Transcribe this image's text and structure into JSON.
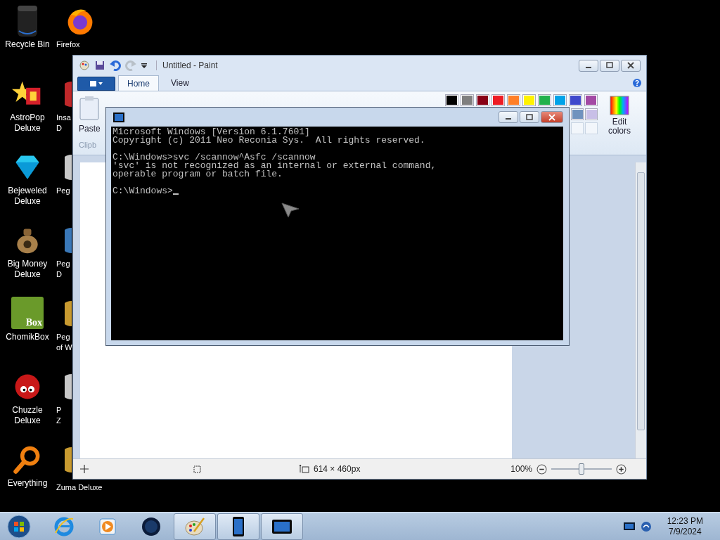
{
  "desktop_icons": [
    {
      "label": [
        "Recycle Bin"
      ],
      "kind": "bin"
    },
    {
      "label": [
        "AstroPop",
        "Deluxe"
      ],
      "kind": "star"
    },
    {
      "label": [
        "Bejeweled",
        "Deluxe"
      ],
      "kind": "gem"
    },
    {
      "label": [
        "Big Money",
        "Deluxe"
      ],
      "kind": "moneybag"
    },
    {
      "label": [
        "ChomikBox"
      ],
      "kind": "box",
      "icon_text": "Box"
    },
    {
      "label": [
        "Chuzzle",
        "Deluxe"
      ],
      "kind": "fuzzball"
    },
    {
      "label": [
        "Everything"
      ],
      "kind": "magnifier"
    }
  ],
  "desktop_icons_column_2": [
    {
      "label": [
        "Firefox"
      ],
      "kind": "firefox"
    },
    {
      "label": [
        "Insa",
        "D"
      ],
      "kind": "red"
    },
    {
      "label": [
        "Peg"
      ],
      "kind": "grey"
    },
    {
      "label": [
        "Peg",
        "D"
      ],
      "kind": "blue"
    },
    {
      "label": [
        "Peg",
        "of W"
      ],
      "kind": "gold"
    },
    {
      "label": [
        "P",
        "Z"
      ],
      "kind": "grey"
    },
    {
      "label": [
        "Zuma Deluxe"
      ],
      "kind": "gold"
    }
  ],
  "paint": {
    "title": "Untitled - Paint",
    "tabs": [
      {
        "label": "Home",
        "selected": true
      },
      {
        "label": "View",
        "selected": false
      }
    ],
    "paste_label": "Paste",
    "group_label": "Clipb",
    "palette": [
      {
        "color": "#000000"
      },
      {
        "color": "#7f7f7f"
      },
      {
        "color": "#880015"
      },
      {
        "color": "#ed1c24"
      },
      {
        "color": "#ff7f27"
      },
      {
        "color": "#fff200"
      },
      {
        "color": "#22b14c"
      },
      {
        "color": "#00a2e8"
      },
      {
        "color": "#3f48cc"
      },
      {
        "color": "#a349a4"
      }
    ],
    "palette_row_2": [
      {
        "color": "#7092be"
      },
      {
        "color": "#c8bfe7"
      }
    ],
    "edit_colors": [
      "Edit",
      "colors"
    ],
    "size": "614 × 460px",
    "zoom": "100%",
    "zoom_slider": {
      "level": 0.5
    }
  },
  "console": {
    "blocks": [
      [
        "Microsoft Windows [Version 6.1.7601]",
        "Copyright (c) 2011 Neo Reconia Sys.  All rights reserved."
      ],
      [
        "C:\\Windows>svc /scannow^Asfc /scannow",
        "'svc' is not recognized as an internal or external command,",
        "operable program or batch file."
      ]
    ],
    "prompt": "C:\\Windows>"
  },
  "taskbar": {
    "buttons": [
      {
        "kind": "ie",
        "open": false
      },
      {
        "kind": "media",
        "open": false
      },
      {
        "kind": "globe",
        "open": false
      },
      {
        "kind": "paint",
        "open": true
      },
      {
        "kind": "tablet",
        "open": true
      },
      {
        "kind": "console",
        "open": true
      }
    ],
    "time": "12:23 PM",
    "date": "7/9/2024"
  }
}
